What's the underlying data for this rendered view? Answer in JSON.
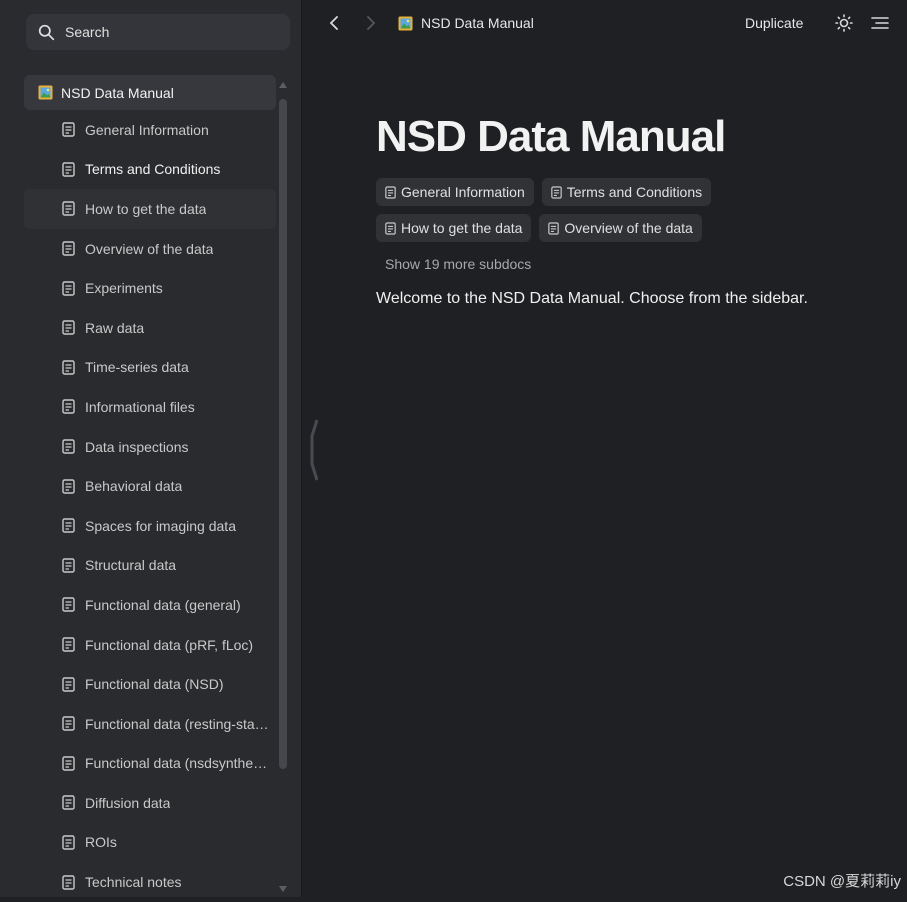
{
  "search": {
    "label": "Search"
  },
  "sidebar": {
    "root": {
      "label": "NSD Data Manual"
    },
    "items": [
      {
        "label": "General Information"
      },
      {
        "label": "Terms and Conditions"
      },
      {
        "label": "How to get the data"
      },
      {
        "label": "Overview of the data"
      },
      {
        "label": "Experiments"
      },
      {
        "label": "Raw data"
      },
      {
        "label": "Time-series data"
      },
      {
        "label": "Informational files"
      },
      {
        "label": "Data inspections"
      },
      {
        "label": "Behavioral data"
      },
      {
        "label": "Spaces for imaging data"
      },
      {
        "label": "Structural data"
      },
      {
        "label": "Functional data (general)"
      },
      {
        "label": "Functional data (pRF, fLoc)"
      },
      {
        "label": "Functional data (NSD)"
      },
      {
        "label": "Functional data (resting-sta…"
      },
      {
        "label": "Functional data (nsdsynthe…"
      },
      {
        "label": "Diffusion data"
      },
      {
        "label": "ROIs"
      },
      {
        "label": "Technical notes"
      }
    ]
  },
  "header": {
    "breadcrumb": "NSD Data Manual",
    "duplicate_label": "Duplicate"
  },
  "main": {
    "title": "NSD Data Manual",
    "subdocs": [
      {
        "label": "General Information"
      },
      {
        "label": "Terms and Conditions"
      },
      {
        "label": "How to get the data"
      },
      {
        "label": "Overview of the data"
      }
    ],
    "more_label": "Show 19 more subdocs",
    "welcome": "Welcome to the NSD Data Manual. Choose from the sidebar."
  },
  "watermark": "CSDN @夏莉莉iy",
  "colors": {
    "background": "#1f2023",
    "sidebar": "#2a2b2e",
    "chip": "#313236",
    "text": "#e6e6e6"
  }
}
